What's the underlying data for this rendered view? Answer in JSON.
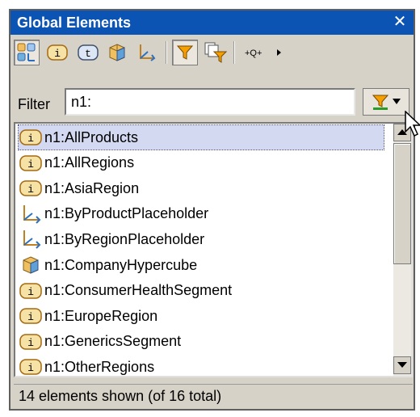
{
  "window": {
    "title": "Global Elements",
    "close_label": "✕"
  },
  "toolbar": {
    "buttons": [
      {
        "icon": "show-all-icon",
        "pressed": true
      },
      {
        "icon": "item-icon",
        "glyph": "i",
        "pressed": false
      },
      {
        "icon": "tuple-icon",
        "glyph": "t",
        "pressed": false
      },
      {
        "icon": "hypercube-icon",
        "pressed": false
      },
      {
        "icon": "dimension-icon",
        "pressed": false
      },
      {
        "icon": "filter-icon",
        "pressed": true
      },
      {
        "icon": "filter-copy-icon",
        "pressed": false
      },
      {
        "icon": "expand-navigation-icon",
        "label": "+₢+",
        "pressed": false
      }
    ]
  },
  "filter": {
    "label": "Filter",
    "value": "n1:"
  },
  "list": {
    "items": [
      {
        "label": "n1:AllProducts",
        "icon": "item-icon",
        "selected": true
      },
      {
        "label": "n1:AllRegions",
        "icon": "item-icon",
        "selected": false
      },
      {
        "label": "n1:AsiaRegion",
        "icon": "item-icon",
        "selected": false
      },
      {
        "label": "n1:ByProductPlaceholder",
        "icon": "dimension-icon",
        "selected": false
      },
      {
        "label": "n1:ByRegionPlaceholder",
        "icon": "dimension-icon",
        "selected": false
      },
      {
        "label": "n1:CompanyHypercube",
        "icon": "hypercube-icon",
        "selected": false
      },
      {
        "label": "n1:ConsumerHealthSegment",
        "icon": "item-icon",
        "selected": false
      },
      {
        "label": "n1:EuropeRegion",
        "icon": "item-icon",
        "selected": false
      },
      {
        "label": "n1:GenericsSegment",
        "icon": "item-icon",
        "selected": false
      },
      {
        "label": "n1:OtherRegions",
        "icon": "item-icon",
        "selected": false
      }
    ]
  },
  "status": {
    "text": "14 elements shown (of 16 total)"
  },
  "colors": {
    "titlebar": "#0c54b4",
    "selection": "#d2d9f0",
    "panel": "#d7d2c8",
    "item_icon_border": "#a46a12",
    "item_icon_fill": "#f7e2a6"
  }
}
